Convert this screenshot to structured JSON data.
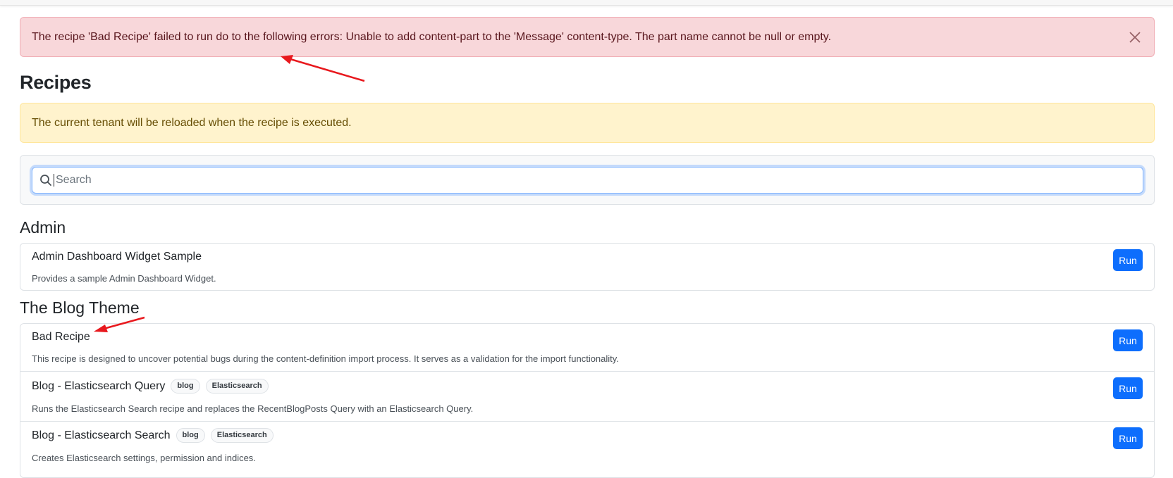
{
  "error_alert": {
    "message": "The recipe 'Bad Recipe' failed to run do to the following errors: Unable to add content-part to the 'Message' content-type. The part name cannot be null or empty.",
    "close_icon": "close-icon"
  },
  "page": {
    "title": "Recipes"
  },
  "warning_alert": {
    "message": "The current tenant will be reloaded when the recipe is executed."
  },
  "search": {
    "placeholder": "Search",
    "value": "",
    "icon": "search-icon"
  },
  "groups": [
    {
      "title": "Admin",
      "recipes": [
        {
          "name": "Admin Dashboard Widget Sample",
          "description": "Provides a sample Admin Dashboard Widget.",
          "tags": [],
          "run_label": "Run"
        }
      ]
    },
    {
      "title": "The Blog Theme",
      "recipes": [
        {
          "name": "Bad Recipe",
          "description": "This recipe is designed to uncover potential bugs during the content-definition import process. It serves as a validation for the import functionality.",
          "tags": [],
          "run_label": "Run"
        },
        {
          "name": "Blog - Elasticsearch Query",
          "description": "Runs the Elasticsearch Search recipe and replaces the RecentBlogPosts Query with an Elasticsearch Query.",
          "tags": [
            "blog",
            "Elasticsearch"
          ],
          "run_label": "Run"
        },
        {
          "name": "Blog - Elasticsearch Search",
          "description": "Creates Elasticsearch settings, permission and indices.",
          "tags": [
            "blog",
            "Elasticsearch"
          ],
          "run_label": "Run"
        }
      ]
    }
  ],
  "colors": {
    "danger_bg": "#f8d7da",
    "warning_bg": "#fff3cd",
    "primary": "#0d6efd",
    "annotation_arrow": "#e8191e"
  }
}
